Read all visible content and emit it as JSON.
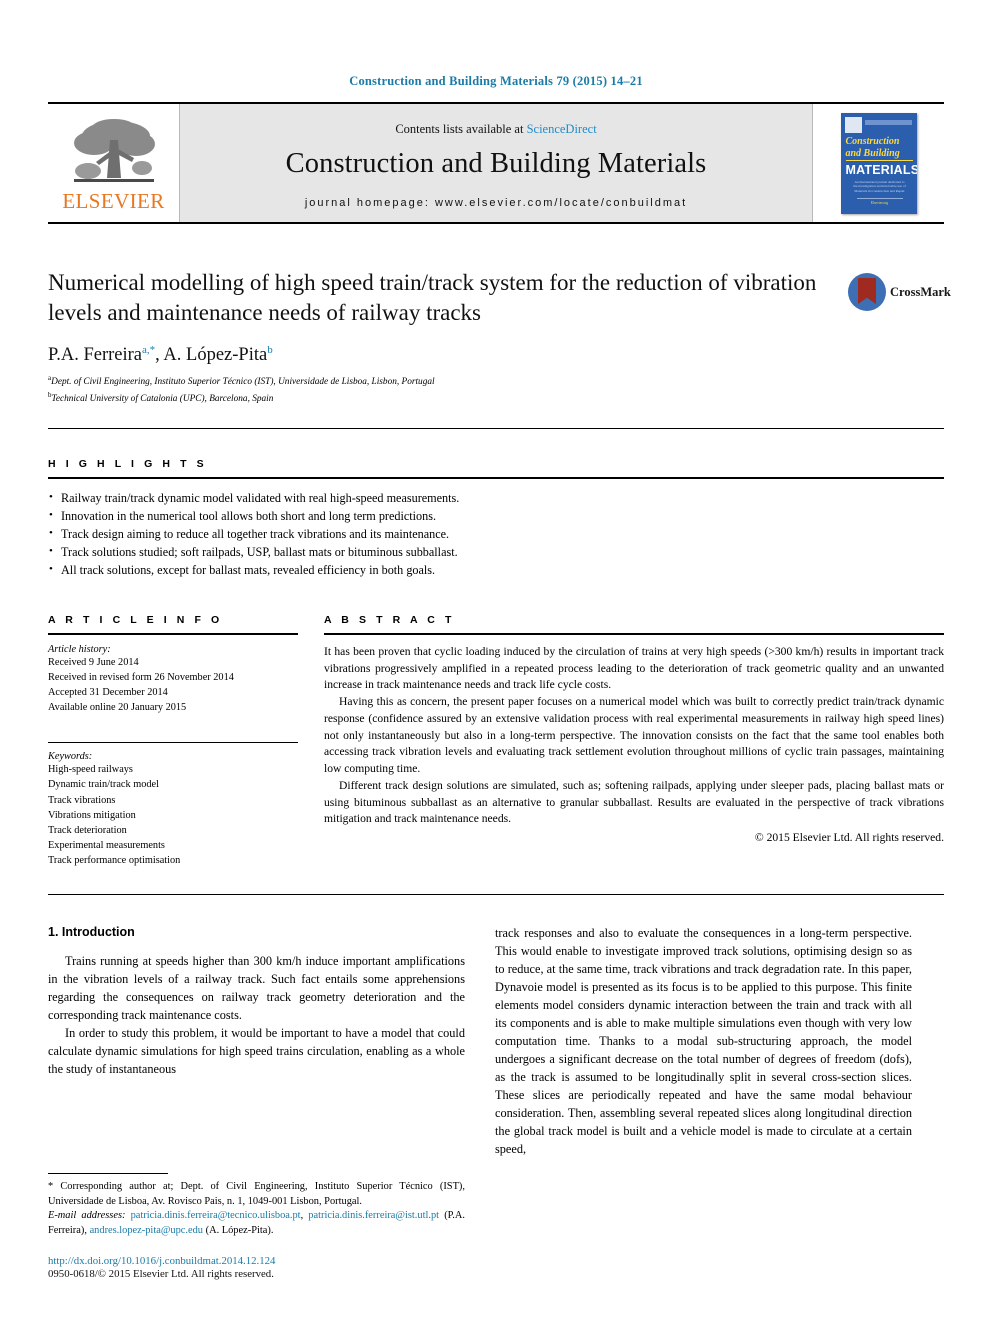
{
  "running_head": "Construction and Building Materials 79 (2015) 14–21",
  "masthead": {
    "contents_prefix": "Contents lists available at ",
    "sciencedirect": "ScienceDirect",
    "journal_title": "Construction and Building Materials",
    "homepage": "journal homepage: www.elsevier.com/locate/conbuildmat",
    "publisher": "ELSEVIER",
    "cover": {
      "line1": "Construction",
      "line2": "and Building",
      "line3": "MATERIALS",
      "subtitle": "An international journal dedicated to the investigation and innovative use of Materials in Construction and Repair",
      "footer": "Elsevier.org"
    }
  },
  "colors": {
    "link_blue": "#1a7ba8",
    "sciencedirect_blue": "#1f8cc9",
    "elsevier_orange": "#e87722",
    "cover_blue": "#2b5fae",
    "cover_yellow": "#ffd83b",
    "crossmark_blue": "#3d6fb4",
    "crossmark_red": "#9e2a20"
  },
  "article": {
    "title": "Numerical modelling of high speed train/track system for the reduction of vibration levels and maintenance needs of railway tracks",
    "authors_html": "P.A. Ferreira, A. López-Pita",
    "author1": "P.A. Ferreira",
    "author1_sup": "a,*",
    "author2": "A. López-Pita",
    "author2_sup": "b",
    "affiliation_a_sup": "a",
    "affiliation_a": "Dept. of Civil Engineering, Instituto Superior Técnico (IST), Universidade de Lisboa, Lisbon, Portugal",
    "affiliation_b_sup": "b",
    "affiliation_b": "Technical University of Catalonia (UPC), Barcelona, Spain",
    "crossmark_label": "CrossMark"
  },
  "highlights": {
    "label": "H I G H L I G H T S",
    "items": [
      "Railway train/track dynamic model validated with real high-speed measurements.",
      "Innovation in the numerical tool allows both short and long term predictions.",
      "Track design aiming to reduce all together track vibrations and its maintenance.",
      "Track solutions studied; soft railpads, USP, ballast mats or bituminous subballast.",
      "All track solutions, except for ballast mats, revealed efficiency in both goals."
    ]
  },
  "article_info": {
    "label": "A R T I C L E   I N F O",
    "history_title": "Article history:",
    "history": [
      "Received 9 June 2014",
      "Received in revised form 26 November 2014",
      "Accepted 31 December 2014",
      "Available online 20 January 2015"
    ],
    "keywords_title": "Keywords:",
    "keywords": [
      "High-speed railways",
      "Dynamic train/track model",
      "Track vibrations",
      "Vibrations mitigation",
      "Track deterioration",
      "Experimental measurements",
      "Track performance optimisation"
    ]
  },
  "abstract": {
    "label": "A B S T R A C T",
    "paragraphs": [
      "It has been proven that cyclic loading induced by the circulation of trains at very high speeds (>300 km/h) results in important track vibrations progressively amplified in a repeated process leading to the deterioration of track geometric quality and an unwanted increase in track maintenance needs and track life cycle costs.",
      "Having this as concern, the present paper focuses on a numerical model which was built to correctly predict train/track dynamic response (confidence assured by an extensive validation process with real experimental measurements in railway high speed lines) not only instantaneously but also in a long-term perspective. The innovation consists on the fact that the same tool enables both accessing track vibration levels and evaluating track settlement evolution throughout millions of cyclic train passages, maintaining low computing time.",
      "Different track design solutions are simulated, such as; softening railpads, applying under sleeper pads, placing ballast mats or using bituminous subballast as an alternative to granular subballast. Results are evaluated in the perspective of track vibrations mitigation and track maintenance needs."
    ],
    "copyright": "© 2015 Elsevier Ltd. All rights reserved."
  },
  "body": {
    "section_heading": "1. Introduction",
    "left_paragraphs": [
      "Trains running at speeds higher than 300 km/h induce important amplifications in the vibration levels of a railway track. Such fact entails some apprehensions regarding the consequences on railway track geometry deterioration and the corresponding track maintenance costs.",
      "In order to study this problem, it would be important to have a model that could calculate dynamic simulations for high speed trains circulation, enabling as a whole the study of instantaneous"
    ],
    "right_paragraphs": [
      "track responses and also to evaluate the consequences in a long-term perspective. This would enable to investigate improved track solutions, optimising design so as to reduce, at the same time, track vibrations and track degradation rate. In this paper, Dynavoie model is presented as its focus is to be applied to this purpose. This finite elements model considers dynamic interaction between the train and track with all its components and is able to make multiple simulations even though with very low computation time. Thanks to a modal sub-structuring approach, the model undergoes a significant decrease on the total number of degrees of freedom (dofs), as the track is assumed to be longitudinally split in several cross-section slices. These slices are periodically repeated and have the same modal behaviour consideration. Then, assembling several repeated slices along longitudinal direction the global track model is built and a vehicle model is made to circulate at a certain speed,"
    ]
  },
  "footnote": {
    "corresponding_marker": "*",
    "corresponding_text": "Corresponding author at; Dept. of Civil Engineering, Instituto Superior Técnico (IST), Universidade de Lisboa, Av. Rovisco Pais, n. 1, 1049-001 Lisbon, Portugal.",
    "email_label": "E-mail addresses:",
    "email1": "patricia.dinis.ferreira@tecnico.ulisboa.pt",
    "email2": "patricia.dinis.ferreira@ist.utl.pt",
    "email1_owner": "(P.A. Ferreira),",
    "email3": "andres.lopez-pita@upc.edu",
    "email3_owner": "(A. López-Pita).",
    "doi": "http://dx.doi.org/10.1016/j.conbuildmat.2014.12.124",
    "issn": "0950-0618/© 2015 Elsevier Ltd. All rights reserved."
  }
}
